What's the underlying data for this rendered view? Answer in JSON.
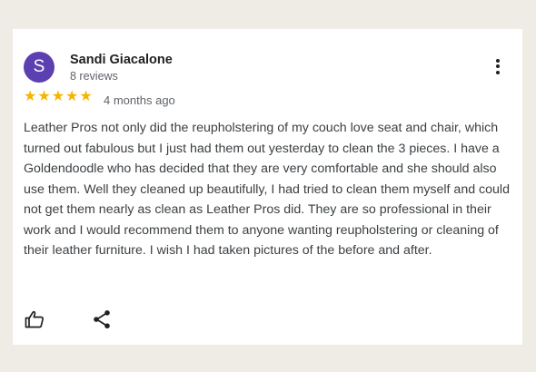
{
  "review": {
    "avatar_letter": "S",
    "avatar_color": "#5c3fb0",
    "author": "Sandi Giacalone",
    "review_count": "8 reviews",
    "rating": 5,
    "rating_max": 5,
    "star_glyph": "★",
    "star_color": "#f6b400",
    "time_ago": "4 months ago",
    "text": "Leather Pros not only did the reupholstering of my couch love seat and chair, which turned out fabulous but I just had them out yesterday to clean the 3 pieces. I have a Goldendoodle who has decided that they are very comfortable and she should also use them. Well they cleaned up beautifully, I had tried to clean them myself and could not get them nearly as clean as Leather Pros did. They are so professional in their work and I would recommend them to anyone wanting reupholstering or cleaning of their leather furniture. I wish I had taken pictures of the before and after.",
    "more_icon": "more-vert-icon",
    "actions": {
      "like_icon": "thumbs-up-icon",
      "share_icon": "share-icon"
    }
  }
}
